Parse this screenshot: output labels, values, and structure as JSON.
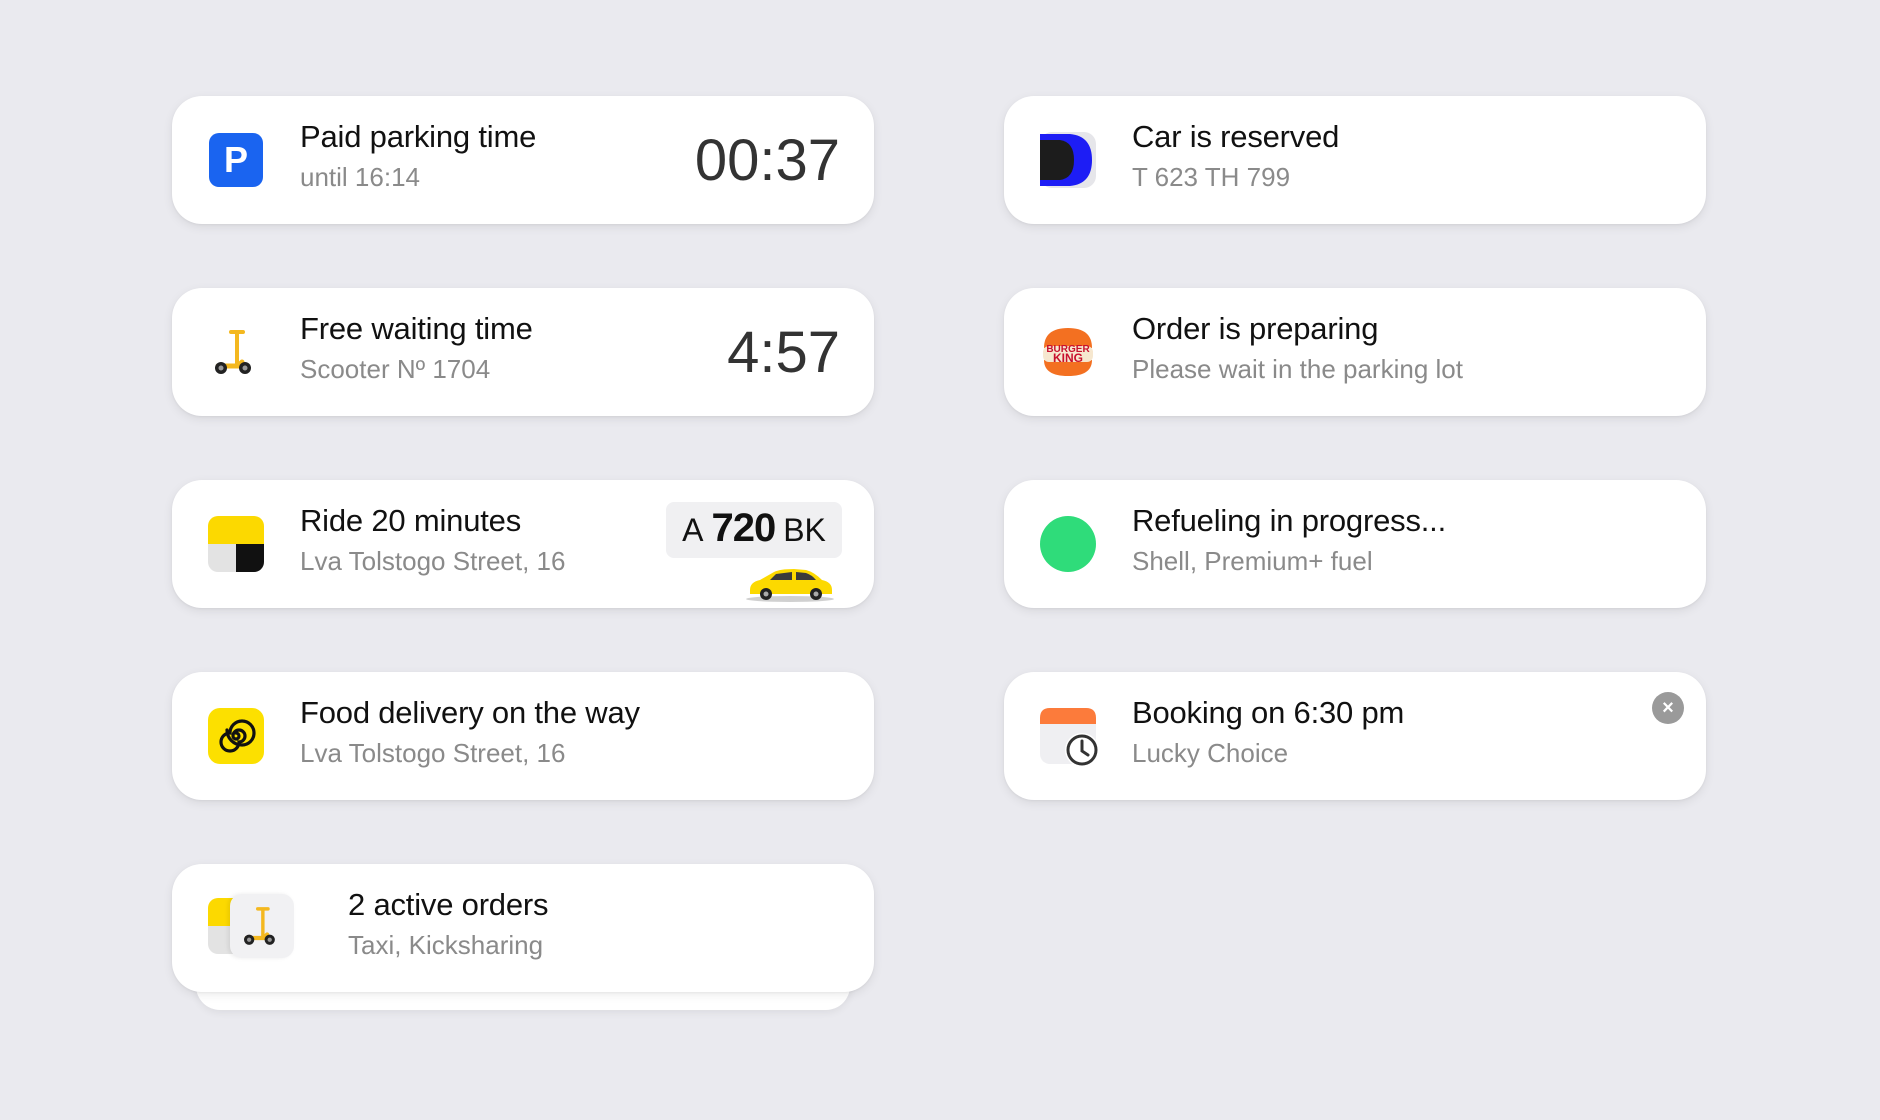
{
  "cards": {
    "parking": {
      "title": "Paid parking time",
      "subtitle": "until 16:14",
      "timer": "00:37",
      "icon": "parking-icon",
      "icon_color": "#1a64f0",
      "icon_letter": "P"
    },
    "scooter": {
      "title": "Free waiting time",
      "subtitle": "Scooter Nº 1704",
      "timer": "4:57",
      "icon": "scooter-icon"
    },
    "taxi": {
      "title": "Ride 20 minutes",
      "subtitle": "Lva Tolstogo Street, 16",
      "icon": "taxi-icon",
      "plate": {
        "series": "A",
        "number": "720",
        "region": "BK"
      }
    },
    "food": {
      "title": "Food delivery on the way",
      "subtitle": "Lva Tolstogo Street, 16",
      "icon": "food-delivery-icon",
      "icon_color": "#fce000"
    },
    "multi": {
      "title": "2 active orders",
      "subtitle": "Taxi, Kicksharing",
      "icon": "taxi-and-scooter-icon"
    },
    "car": {
      "title": "Car is reserved",
      "subtitle": "T 623 TH 799",
      "icon": "carsharing-icon"
    },
    "burger": {
      "title": "Order is preparing",
      "subtitle": "Please wait in the parking lot",
      "icon": "burger-king-logo",
      "logo_text": [
        "BURGER",
        "KING"
      ]
    },
    "fuel": {
      "title": "Refueling in progress...",
      "subtitle": "Shell, Premium+ fuel",
      "icon": "green-dot-icon",
      "icon_color": "#2fdc7a"
    },
    "booking": {
      "title": "Booking on 6:30 pm",
      "subtitle": "Lucky Choice",
      "icon": "calendar-clock-icon",
      "close_glyph": "×"
    }
  },
  "colors": {
    "background": "#eaeaef",
    "card": "#ffffff",
    "title": "#111111",
    "subtitle": "#8a8a8a",
    "taxi_yellow": "#fcd900"
  }
}
